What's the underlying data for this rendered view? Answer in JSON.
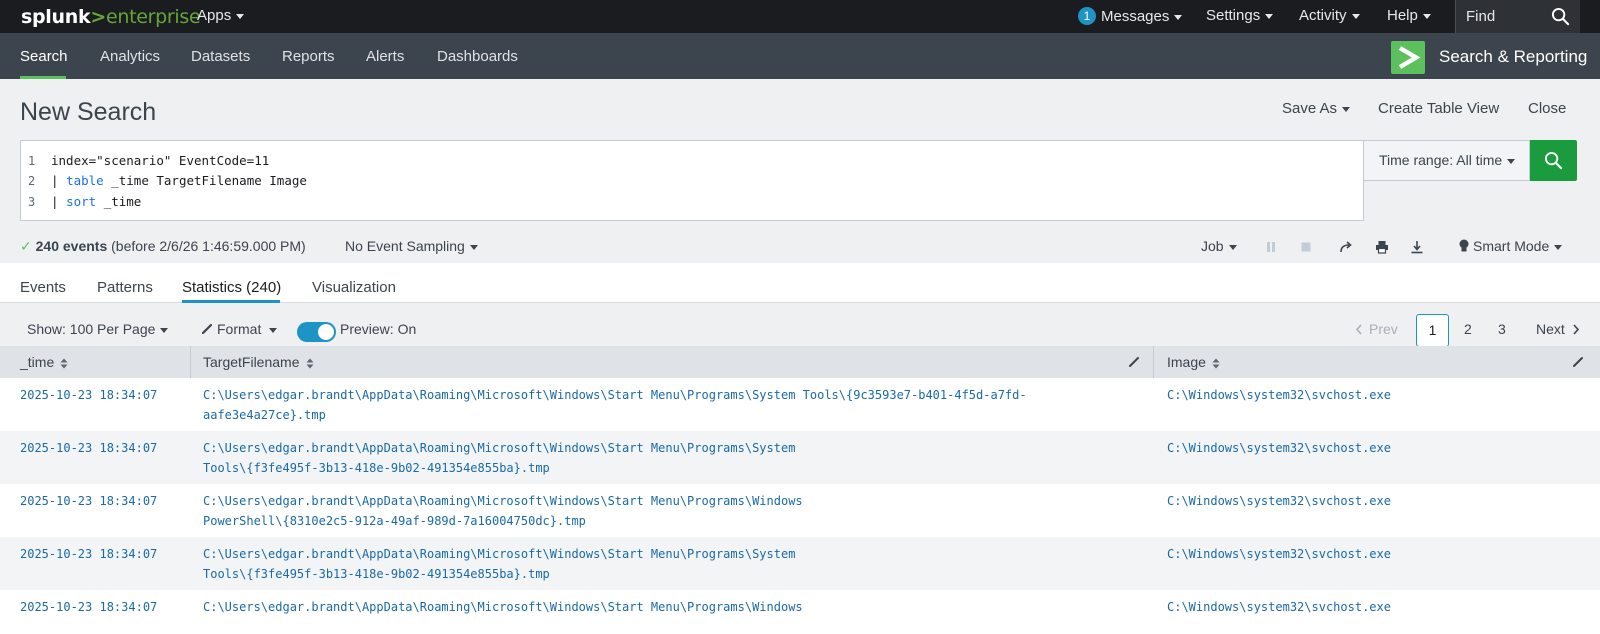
{
  "topbar": {
    "logo_word": "splunk",
    "logo_gt": ">",
    "logo_product": "enterprise",
    "apps": "Apps",
    "messages_count": "1",
    "messages": "Messages",
    "settings": "Settings",
    "activity": "Activity",
    "help": "Help",
    "find": "Find"
  },
  "appbar": {
    "nav": [
      "Search",
      "Analytics",
      "Datasets",
      "Reports",
      "Alerts",
      "Dashboards"
    ],
    "app_title": "Search & Reporting"
  },
  "search": {
    "title": "New Search",
    "save_as": "Save As",
    "create_table_view": "Create Table View",
    "close": "Close",
    "line_numbers": [
      "1",
      "2",
      "3"
    ],
    "query_lines": [
      {
        "pre": "index=\"scenario\" EventCode=11",
        "kw": "",
        "post": ""
      },
      {
        "pre": "| ",
        "kw": "table",
        "post": " _time TargetFilename Image"
      },
      {
        "pre": "| ",
        "kw": "sort",
        "post": " _time"
      }
    ],
    "time_range": "Time range: All time"
  },
  "status": {
    "count": "240 events",
    "detail": "(before 2/6/26 1:46:59.000 PM)",
    "sampling": "No Event Sampling",
    "job": "Job",
    "mode": "Smart Mode"
  },
  "tabs": [
    "Events",
    "Patterns",
    "Statistics (240)",
    "Visualization"
  ],
  "toolbar": {
    "show": "Show: 100 Per Page",
    "format": "Format",
    "preview": "Preview: On",
    "prev": "Prev",
    "pages": [
      "1",
      "2",
      "3"
    ],
    "next": "Next"
  },
  "table": {
    "columns": [
      "_time",
      "TargetFilename",
      "Image"
    ],
    "rows": [
      {
        "time": "2025-10-23 18:34:07",
        "file1": "C:\\Users\\edgar.brandt\\AppData\\Roaming\\Microsoft\\Windows\\Start Menu\\Programs\\System Tools\\{9c3593e7-b401-4f5d-a7fd-",
        "file2": "aafe3e4a27ce}.tmp",
        "image": "C:\\Windows\\system32\\svchost.exe"
      },
      {
        "time": "2025-10-23 18:34:07",
        "file1": "C:\\Users\\edgar.brandt\\AppData\\Roaming\\Microsoft\\Windows\\Start Menu\\Programs\\System",
        "file2": "Tools\\{f3fe495f-3b13-418e-9b02-491354e855ba}.tmp",
        "image": "C:\\Windows\\system32\\svchost.exe"
      },
      {
        "time": "2025-10-23 18:34:07",
        "file1": "C:\\Users\\edgar.brandt\\AppData\\Roaming\\Microsoft\\Windows\\Start Menu\\Programs\\Windows",
        "file2": "PowerShell\\{8310e2c5-912a-49af-989d-7a16004750dc}.tmp",
        "image": "C:\\Windows\\system32\\svchost.exe"
      },
      {
        "time": "2025-10-23 18:34:07",
        "file1": "C:\\Users\\edgar.brandt\\AppData\\Roaming\\Microsoft\\Windows\\Start Menu\\Programs\\System",
        "file2": "Tools\\{f3fe495f-3b13-418e-9b02-491354e855ba}.tmp",
        "image": "C:\\Windows\\system32\\svchost.exe"
      },
      {
        "time": "2025-10-23 18:34:07",
        "file1": "C:\\Users\\edgar.brandt\\AppData\\Roaming\\Microsoft\\Windows\\Start Menu\\Programs\\Windows",
        "file2": "",
        "image": "C:\\Windows\\system32\\svchost.exe"
      }
    ]
  },
  "colors": {
    "topbar": "#1a1c20",
    "appbar": "#3c444d",
    "accent_green": "#5cc05c",
    "search_button": "#1a9c3e",
    "link_blue": "#1a6aa8",
    "tab_active": "#1e93c6"
  }
}
